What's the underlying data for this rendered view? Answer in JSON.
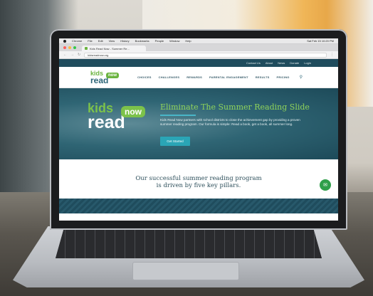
{
  "menubar": {
    "items": [
      "Chrome",
      "File",
      "Edit",
      "View",
      "History",
      "Bookmarks",
      "People",
      "Window",
      "Help"
    ],
    "status": "Sat Feb 15  10:20 PM"
  },
  "browser": {
    "tab_title": "Kids Read Now - Summer Re...",
    "url": "kidsreadnow.org"
  },
  "site": {
    "topbar": [
      "Contact Us",
      "About",
      "News",
      "Donate",
      "Login"
    ],
    "logo": {
      "kids": "kids",
      "read": "read",
      "now": "now"
    },
    "nav": [
      "CHOICES",
      "CHALLENGES",
      "REWARDS",
      "PARENTAL ENGAGEMENT",
      "RESULTS",
      "PRICING"
    ],
    "hero": {
      "title": "Eliminate The Summer Reading Slide",
      "text": "Kids Read Now partners with school districts to close the achievement gap by providing a proven summer reading program. Our formula is simple: Read a book, get a book, all summer long.",
      "button": "Get Started"
    },
    "pillars": {
      "line1": "Our successful summer reading program",
      "line2": "is driven by five key pillars."
    }
  },
  "colors": {
    "brand_teal": "#1f4c5d",
    "brand_green": "#7cc24a",
    "button": "#2aa5b6",
    "chat": "#2e9f4a"
  }
}
